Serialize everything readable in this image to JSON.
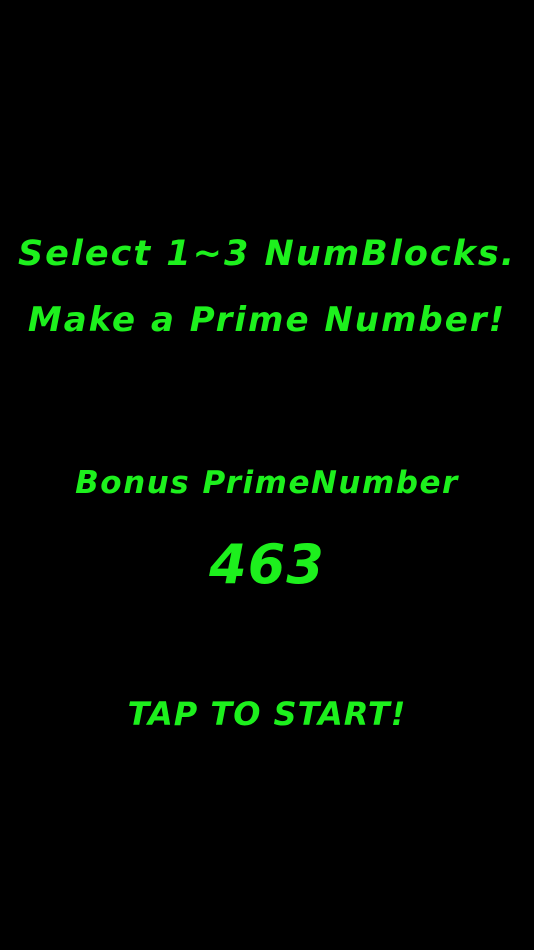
{
  "instructions": {
    "line1": "Select 1~3 NumBlocks.",
    "line2": "Make a Prime Number!"
  },
  "bonus": {
    "label": "Bonus PrimeNumber",
    "number": "463"
  },
  "start_prompt": "TAP TO START!",
  "colors": {
    "background": "#000000",
    "text": "#1df01d"
  }
}
